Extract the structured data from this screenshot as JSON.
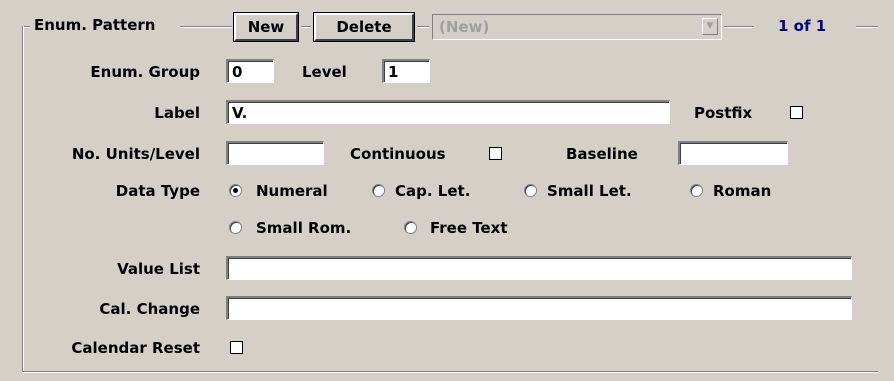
{
  "group": {
    "title": "Enum. Pattern"
  },
  "toolbar": {
    "new_label": "New",
    "delete_label": "Delete",
    "selector_value": "(New)",
    "record_counter": "1 of 1"
  },
  "fields": {
    "enum_group": {
      "label": "Enum. Group",
      "value": "0"
    },
    "level": {
      "label": "Level",
      "value": "1"
    },
    "label": {
      "label": "Label",
      "value": "V."
    },
    "postfix": {
      "label": "Postfix",
      "checked": false
    },
    "units_per_level": {
      "label": "No. Units/Level",
      "value": ""
    },
    "continuous": {
      "label": "Continuous",
      "checked": false
    },
    "baseline": {
      "label": "Baseline",
      "value": ""
    },
    "data_type": {
      "label": "Data Type",
      "options": [
        "Numeral",
        "Cap. Let.",
        "Small Let.",
        "Roman",
        "Small Rom.",
        "Free Text"
      ],
      "selected": "Numeral"
    },
    "value_list": {
      "label": "Value List",
      "value": ""
    },
    "cal_change": {
      "label": "Cal. Change",
      "value": ""
    },
    "calendar_reset": {
      "label": "Calendar Reset",
      "checked": false
    }
  },
  "colors": {
    "background": "#d4d0c8",
    "counter_text": "#000080",
    "disabled_text": "#a0a0a0"
  },
  "icons": {
    "combo_arrow": "chevron-down-icon"
  }
}
